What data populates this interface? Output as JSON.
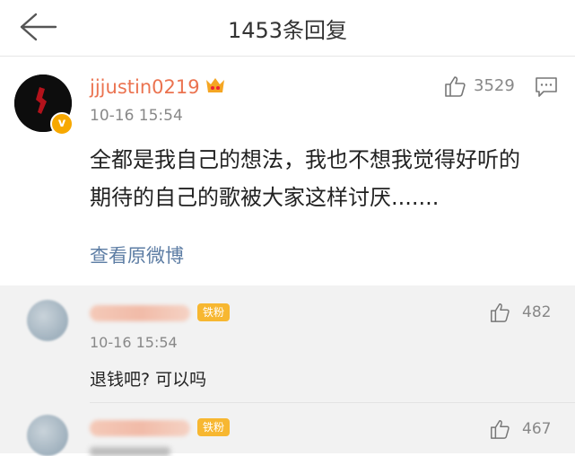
{
  "header": {
    "title": "1453条回复"
  },
  "post": {
    "username": "jjjustin0219",
    "time": "10-16 15:54",
    "likes": "3529",
    "content_line1": "全都是我自己的想法，我也不想我觉得好听的",
    "content_line2": "期待的自己的歌被大家这样讨厌.......",
    "source_link": "查看原微博"
  },
  "replies": [
    {
      "badge": "铁粉",
      "likes": "482",
      "time": "10-16 15:54",
      "text": "退钱吧? 可以吗"
    },
    {
      "badge": "铁粉",
      "likes": "467"
    }
  ],
  "icons": {
    "back": "back-arrow-icon",
    "like": "thumbs-up-icon",
    "reply": "comment-icon",
    "verified": "verified-v-icon"
  },
  "colors": {
    "username": "#eb7350",
    "link": "#5d7da4",
    "badge": "#f7b731"
  }
}
